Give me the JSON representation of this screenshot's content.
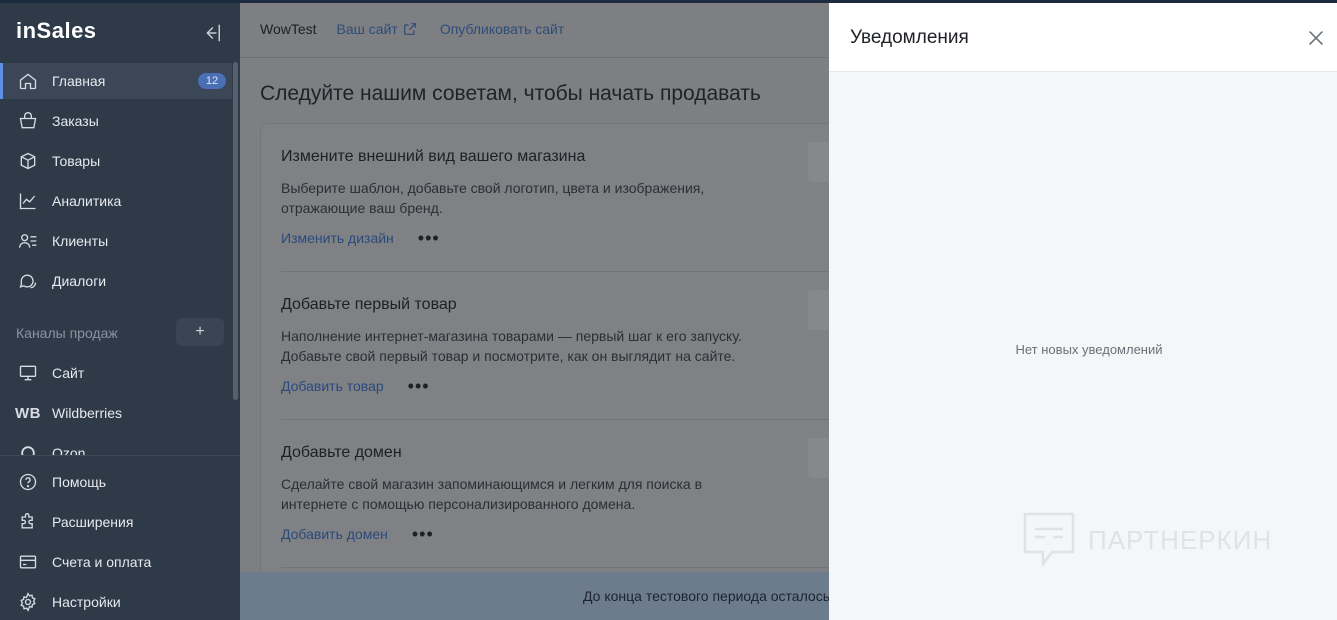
{
  "sidebar": {
    "logo": "inSales",
    "nav": [
      {
        "label": "Главная",
        "badge": "12"
      },
      {
        "label": "Заказы"
      },
      {
        "label": "Товары"
      },
      {
        "label": "Аналитика"
      },
      {
        "label": "Клиенты"
      },
      {
        "label": "Диалоги"
      }
    ],
    "channels_title": "Каналы продаж",
    "channels_add": "+",
    "channels": [
      {
        "label": "Сайт"
      },
      {
        "label": "Wildberries",
        "icon_text": "WB"
      },
      {
        "label": "Ozon"
      }
    ],
    "bottom": [
      {
        "label": "Помощь"
      },
      {
        "label": "Расширения"
      },
      {
        "label": "Счета и оплата"
      },
      {
        "label": "Настройки"
      }
    ]
  },
  "header": {
    "store_name": "WowTest",
    "your_site": "Ваш сайт",
    "publish": "Опубликовать сайт"
  },
  "main": {
    "title": "Следуйте нашим советам, чтобы начать продавать",
    "tips": [
      {
        "title": "Измените внешний вид вашего магазина",
        "desc": "Выберите шаблон, добавьте свой логотип, цвета и изображения, отражающие ваш бренд.",
        "action": "Изменить дизайн",
        "more": "•••"
      },
      {
        "title": "Добавьте первый товар",
        "desc": "Наполнение интернет-магазина товарами — первый шаг к его запуску. Добавьте свой первый товар и посмотрите, как он выглядит на сайте.",
        "action": "Добавить товар",
        "more": "•••"
      },
      {
        "title": "Добавьте домен",
        "desc": "Сделайте свой магазин запоминающимся и легким для поиска в интернете с помощью персонализированного домена.",
        "action": "Добавить домен",
        "more": "•••"
      }
    ],
    "trial_notice": "До конца тестового периода осталось"
  },
  "notifications": {
    "title": "Уведомления",
    "empty": "Нет новых уведомлений"
  },
  "watermark": "ПАРТНЕРКИН"
}
